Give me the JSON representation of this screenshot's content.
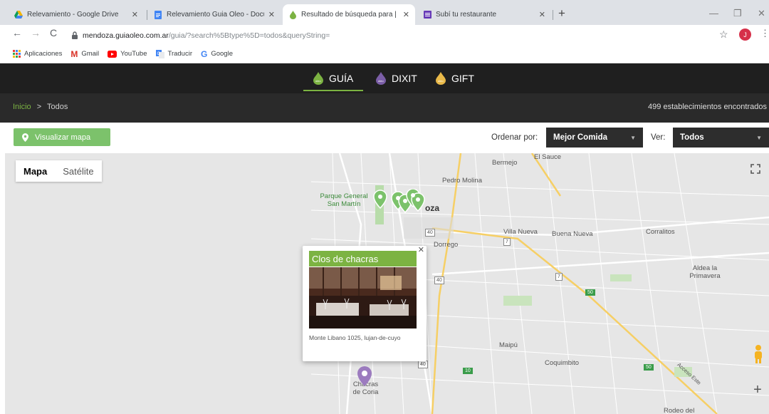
{
  "browser": {
    "tabs": [
      {
        "title": "Relevamiento - Google Drive",
        "icon": "google-drive-icon"
      },
      {
        "title": "Relevamiento Guia Oleo - Docum",
        "icon": "google-docs-icon"
      },
      {
        "title": "Resultado de búsqueda para | Gu",
        "icon": "guiaoleo-drop-icon"
      },
      {
        "title": "Subí tu restaurante",
        "icon": "google-forms-icon"
      }
    ],
    "url_domain": "mendoza.guiaoleo.com.ar",
    "url_path": "/guia/?search%5Btype%5D=todos&queryString=",
    "profile_initial": "J",
    "bookmarks": [
      "Aplicaciones",
      "Gmail",
      "YouTube",
      "Traducir",
      "Google"
    ]
  },
  "site": {
    "nav": [
      {
        "label": "GUÍA",
        "color": "#7cb342"
      },
      {
        "label": "DIXIT",
        "color": "#7b5ea7"
      },
      {
        "label": "GIFT",
        "color": "#e9b949"
      }
    ],
    "breadcrumb": {
      "home": "Inicio",
      "separator": ">",
      "current": "Todos"
    },
    "results_count": "499 establecimientos encontrados",
    "map_button": "Visualizar mapa",
    "sort_label": "Ordenar por:",
    "sort_value": "Mejor Comida",
    "view_label": "Ver:",
    "view_value": "Todos",
    "accent_color": "#7cb342"
  },
  "map": {
    "type_controls": [
      "Mapa",
      "Satélite"
    ],
    "place_labels": [
      "El Sauce",
      "Bermejo",
      "Pedro Molina",
      "Parque General San Martín",
      "oza",
      "Villa Nueva",
      "Buena Nueva",
      "Corralitos",
      "Dorrego",
      "Aldea la Primavera",
      "Maipú",
      "Coquimbito",
      "Chacras de Coria",
      "Rodeo del",
      "Acceso Este"
    ],
    "road_shields": [
      "40",
      "7",
      "40",
      "7",
      "40",
      "50",
      "10",
      "50"
    ],
    "popup": {
      "title": "Clos de chacras",
      "address": "Monte Libano 1025, lujan-de-cuyo"
    }
  }
}
